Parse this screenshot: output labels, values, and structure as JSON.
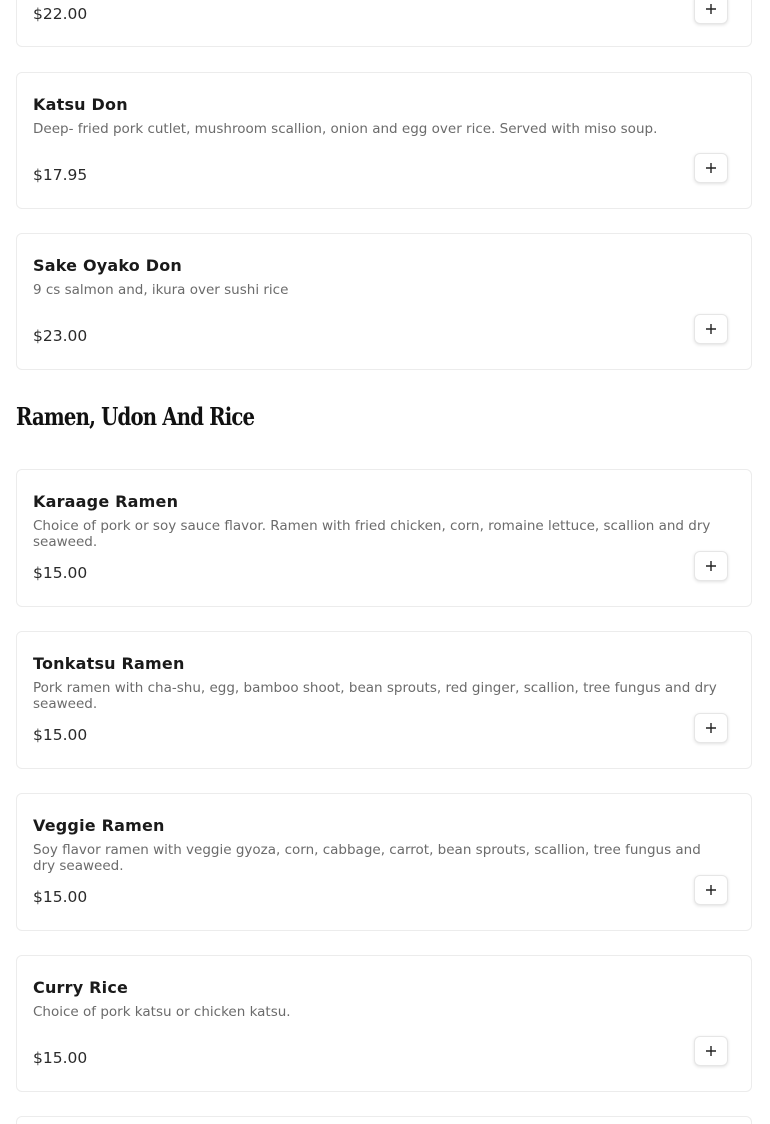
{
  "items_top": [
    {
      "name": "",
      "description": "",
      "price": "$22.00"
    },
    {
      "name": "Katsu Don",
      "description": "Deep- fried pork cutlet, mushroom scallion, onion and egg over rice. Served with miso soup.",
      "price": "$17.95"
    },
    {
      "name": "Sake Oyako Don",
      "description": "9 cs salmon and, ikura over sushi rice",
      "price": "$23.00"
    }
  ],
  "section": {
    "title": "Ramen, Udon And Rice"
  },
  "items_section": [
    {
      "name": "Karaage Ramen",
      "description": "Choice of pork or soy sauce flavor. Ramen with fried chicken, corn, romaine lettuce, scallion and dry seaweed.",
      "price": "$15.00"
    },
    {
      "name": "Tonkatsu Ramen",
      "description": "Pork ramen with cha-shu, egg, bamboo shoot, bean sprouts, red ginger, scallion, tree fungus and dry seaweed.",
      "price": "$15.00"
    },
    {
      "name": "Veggie Ramen",
      "description": "Soy flavor ramen with veggie gyoza, corn, cabbage, carrot, bean sprouts, scallion, tree fungus and dry seaweed.",
      "price": "$15.00"
    },
    {
      "name": "Curry Rice",
      "description": "Choice of pork katsu or chicken katsu.",
      "price": "$15.00"
    }
  ],
  "icons": {
    "add": "plus-icon"
  }
}
